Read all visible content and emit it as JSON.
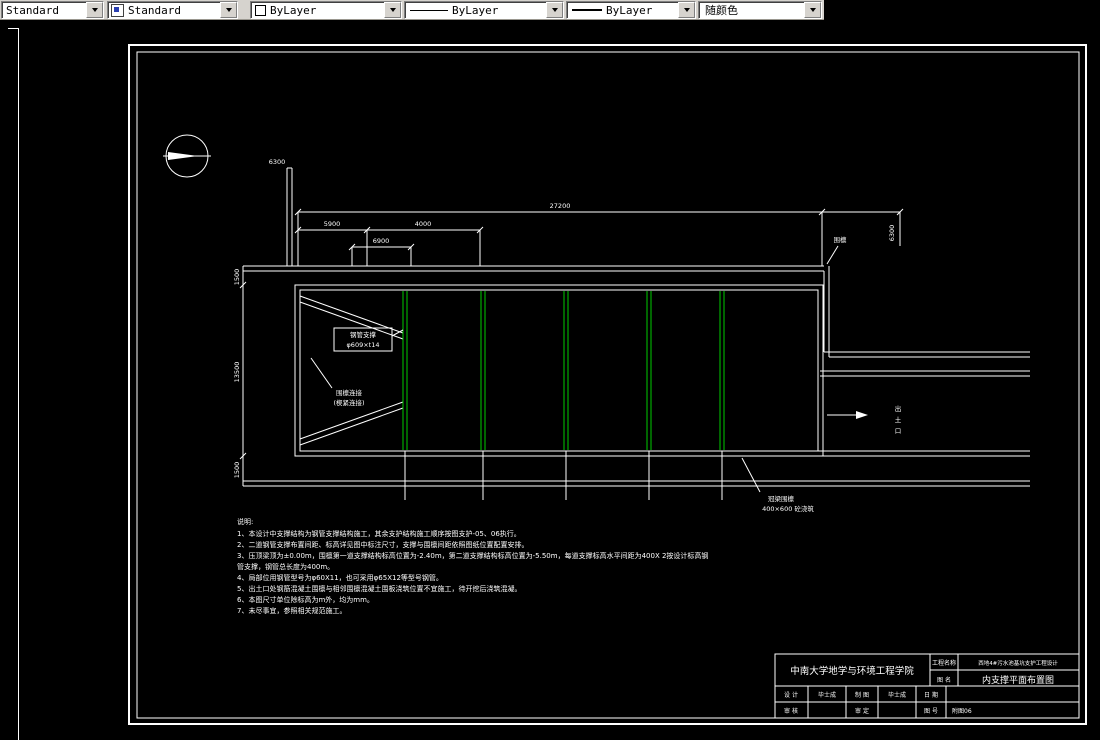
{
  "colors": {
    "support_green": "#00cc00",
    "line_white": "#ffffff",
    "toolbar_gray": "#d6d3ce"
  },
  "toolbar": {
    "dim_style": "Standard",
    "text_style": "Standard",
    "color": "ByLayer",
    "linetype": "ByLayer",
    "lineweight": "ByLayer",
    "plot_style": "随颜色"
  },
  "drawing": {
    "dimensions": {
      "total_top": "27200",
      "seg1": "5900",
      "seg2": "4000",
      "seg3": "6900",
      "left_wall_top": "6300",
      "right_side": "6300",
      "left_top": "1500",
      "left_main": "13500",
      "left_bottom": "1500"
    },
    "labels": {
      "waler": "围檩",
      "pipe_support_1": "钢管支撑",
      "pipe_support_2": "φ609×t14",
      "waler_conn_1": "围檩连接",
      "waler_conn_2": "(楔紧连接)",
      "soil_exit_c1": "出",
      "soil_exit_c2": "土",
      "soil_exit_c3": "口",
      "crown_beam_1": "冠梁围檩",
      "crown_beam_2": "400×600 砼浇筑"
    },
    "notes": {
      "header": "说明:",
      "lines": [
        "1、本设计中支撑结构为钢管支撑结构施工，其余支护结构施工顺序按图支护-05、06执行。",
        "2、二道钢管支撑布置间距、标高详见图中标注尺寸，支撑与围檩间距依照图纸位置配置安排。",
        "3、压顶梁顶为±0.00m，围檩第一道支撑结构标高位置为-2.40m，第二道支撑结构标高位置为-5.50m，每道支撑标高水平间距为400X 2按设计标高钢",
        "管支撑，钢管总长度为400m。",
        "4、局部位用钢管型号为φ60X11，也可采用φ65X12等型号钢管。",
        "5、出土口处钢筋混凝土围檩与相邻围檩混凝土围板浇筑位置不宜施工，待开挖后浇筑混凝。",
        "6、本图尺寸单位除标高为m外，均为mm。",
        "7、未尽事宜，参照相关规范施工。"
      ]
    },
    "titleblock": {
      "school": "中南大学地学与环境工程学院",
      "project_label": "工程名称",
      "project_value": "西地4#污水池基坑支护工程设计",
      "drawing_label": "图  名",
      "drawing_value": "内支撑平面布置图",
      "design_label": "设 计",
      "design_value": "毕士成",
      "draft_label": "制 图",
      "draft_value": "毕士成",
      "date_label": "日 期",
      "date_value": "",
      "check_label": "审 核",
      "check_value": "",
      "approve_label": "审 定",
      "approve_value": "",
      "number_label": "图 号",
      "number_value": "附图06"
    }
  }
}
